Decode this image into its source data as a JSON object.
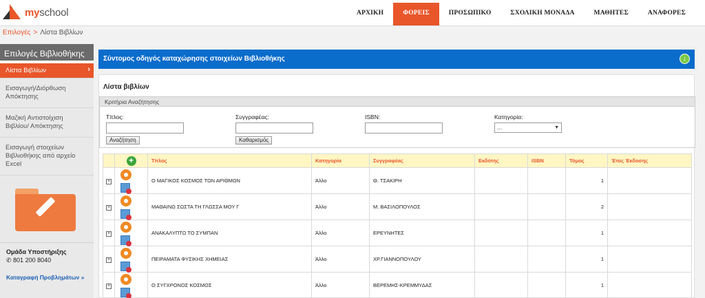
{
  "header": {
    "logo_brand": "my",
    "logo_rest": "school",
    "nav": [
      "ΑΡΧΙΚΗ",
      "ΦΟΡΕΙΣ",
      "ΠΡΟΣΩΠΙΚΟ",
      "ΣΧΟΛΙΚΗ ΜΟΝΑΔΑ",
      "ΜΑΘΗΤΕΣ",
      "ΑΝΑΦΟΡΕΣ"
    ],
    "active_nav": "ΦΟΡΕΙΣ"
  },
  "breadcrumb": {
    "link": "Επιλογές",
    "separator": ">",
    "current": "Λίστα Βιβλίων"
  },
  "sidebar": {
    "title": "Επιλογές Βιβλιοθήκης",
    "items": [
      {
        "label": "Λίστα Βιβλίων",
        "active": true
      },
      {
        "label": "Εισαγωγή/Διόρθωση Απόκτησης"
      },
      {
        "label": "Μαζική Αντιστοίχιση Βιβλίου/ Απόκτησης"
      },
      {
        "label": "Εισαγωγή στοιχείων Βιβλιοθήκης από αρχείο Excel"
      }
    ],
    "support_title": "Ομάδα Υποστήριξης",
    "support_phone": "801 200 8040",
    "support_link": "Καταγραφή Προβλημάτων »"
  },
  "guide": {
    "title": "Σύντομος οδηγός καταχώρησης στοιχείων Βιβλιοθήκης",
    "icon": "download-arrow-icon"
  },
  "list": {
    "title": "Λίστα βιβλίων",
    "criteria_title": "Κριτήρια Αναζήτησης",
    "fields": {
      "title_label": "Τίτλος:",
      "author_label": "Συγγραφέας:",
      "isbn_label": "ISBN:",
      "category_label": "Κατηγορία:",
      "category_value": "..."
    },
    "search_button": "Αναζήτηση",
    "clear_button": "Καθαρισμός"
  },
  "table": {
    "headers": [
      "Τίτλος",
      "Κατηγορία",
      "Συγγραφέας",
      "Εκδότης",
      "ISBN",
      "Τόμος",
      "Έτος Έκδοσης"
    ],
    "rows": [
      [
        "Ο ΜΑΓΙΚΟΣ ΚΟΣΜΟΣ ΤΩΝ ΑΡΙΘΜΩΝ",
        "Άλλο",
        "Θ. ΤΣΑΚΙΡΗ",
        "",
        "",
        "1",
        ""
      ],
      [
        "ΜΑΘΑΙΝΩ ΣΩΣΤΑ ΤΗ ΓΛΩΣΣΑ ΜΟΥ Γ",
        "Άλλο",
        "Μ. ΒΑΣΙΛΟΠΟΥΛΟΣ",
        "",
        "",
        "2",
        ""
      ],
      [
        "ΑΝΑΚΑΛΥΠΤΩ ΤΟ ΣΥΜΠΑΝ",
        "Άλλο",
        "ΕΡΕΥΝΗΤΕΣ",
        "",
        "",
        "1",
        ""
      ],
      [
        "ΠΕΙΡΑΜΑΤΑ ΦΥΣΙΚΗΣ ΧΗΜΕΙΑΣ",
        "Άλλο",
        "ΧΡ.ΓΙΑΝΝΟΠΟΥΛΟΥ",
        "",
        "",
        "1",
        ""
      ],
      [
        "Ο ΣΥΓΧΡΟΝΟΣ ΚΟΣΜΟΣ",
        "Άλλο",
        "ΒΕΡΕΜΗΣ-ΚΡΕΜΜΥΔΑΣ",
        "",
        "",
        "1",
        ""
      ]
    ]
  }
}
